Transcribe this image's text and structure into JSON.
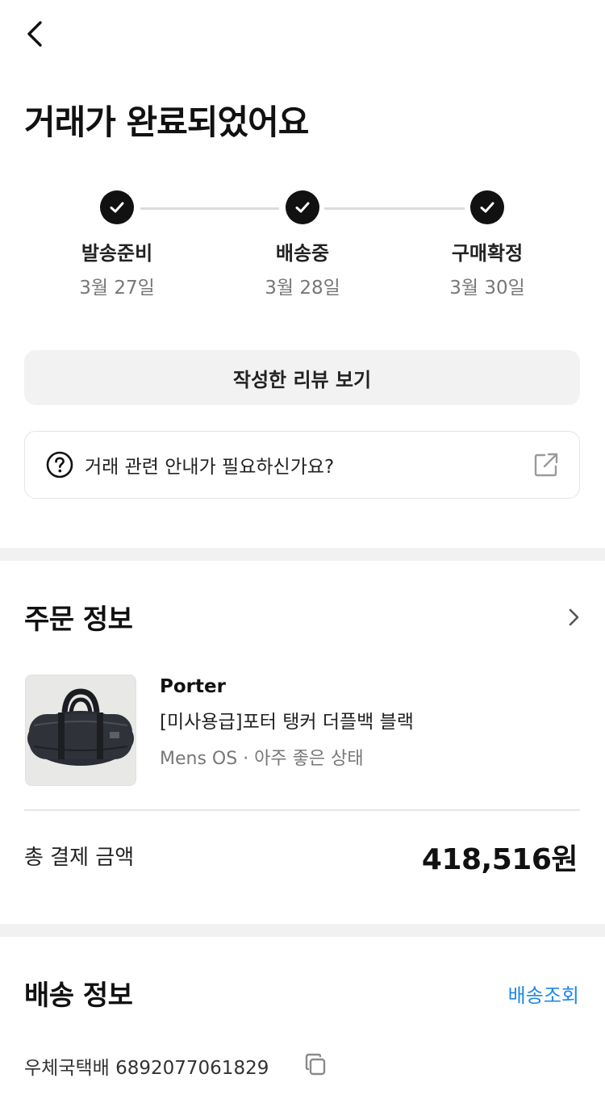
{
  "header": {
    "title": "거래가 완료되었어요"
  },
  "progress": {
    "steps": [
      {
        "label": "발송준비",
        "date": "3월 27일"
      },
      {
        "label": "배송중",
        "date": "3월 28일"
      },
      {
        "label": "구매확정",
        "date": "3월 30일"
      }
    ]
  },
  "actions": {
    "review_label": "작성한 리뷰 보기",
    "help_text": "거래 관련 안내가 필요하신가요?"
  },
  "order": {
    "section_title": "주문 정보",
    "brand": "Porter",
    "product_name": "[미사용급]포터 탱커 더플백 블랙",
    "meta": "Mens OS · 아주 좋은 상태",
    "total_label": "총 결제 금액",
    "total_value": "418,516원"
  },
  "shipping": {
    "section_title": "배송 정보",
    "track_label": "배송조회",
    "courier_tracking": "우체국택배 6892077061829"
  },
  "colors": {
    "accent_link": "#1e88e5",
    "check_bg": "#111111",
    "divider": "#f1f1f1"
  },
  "icons": [
    "back-arrow-icon",
    "check-icon",
    "question-circle-icon",
    "external-link-icon",
    "chevron-right-icon",
    "copy-icon"
  ]
}
